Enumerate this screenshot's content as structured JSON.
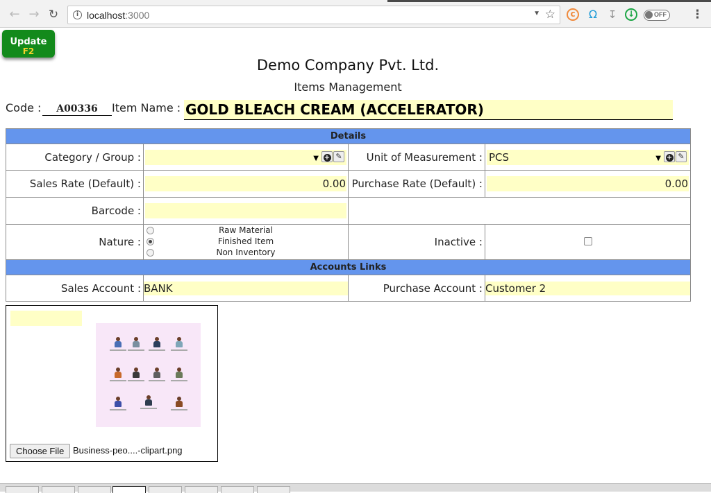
{
  "browser": {
    "url_host": "localhost",
    "url_port": ":3000",
    "toggle_label": "OFF"
  },
  "toolbar": {
    "update_label": "Update",
    "update_shortcut": "F2"
  },
  "header": {
    "company": "Demo Company Pvt. Ltd.",
    "module": "Items Management"
  },
  "item": {
    "code_label": "Code :",
    "code_value": "A00336",
    "name_label": "Item Name :",
    "name_value": "GOLD BLEACH CREAM (ACCELERATOR)"
  },
  "details": {
    "section_title": "Details",
    "category_label": "Category / Group :",
    "category_value": "",
    "uom_label": "Unit of Measurement :",
    "uom_value": "PCS",
    "sales_rate_label": "Sales Rate (Default) :",
    "sales_rate_value": "0.00",
    "purchase_rate_label": "Purchase Rate (Default) :",
    "purchase_rate_value": "0.00",
    "barcode_label": "Barcode :",
    "barcode_value": "",
    "nature_label": "Nature :",
    "nature_options": [
      "Raw Material",
      "Finished Item",
      "Non Inventory"
    ],
    "nature_selected": "Finished Item",
    "inactive_label": "Inactive :",
    "inactive_checked": false
  },
  "accounts": {
    "section_title": "Accounts Links",
    "sales_account_label": "Sales Account :",
    "sales_account_value": "BANK",
    "purchase_account_label": "Purchase Account :",
    "purchase_account_value": "Customer 2"
  },
  "image": {
    "choose_file_label": "Choose File",
    "file_name": "Business-peo....-clipart.png"
  },
  "colors": {
    "section_header": "#6495ed",
    "field_background": "#ffffc6",
    "update_button": "#138a1b",
    "update_shortcut": "#f6d22a"
  }
}
